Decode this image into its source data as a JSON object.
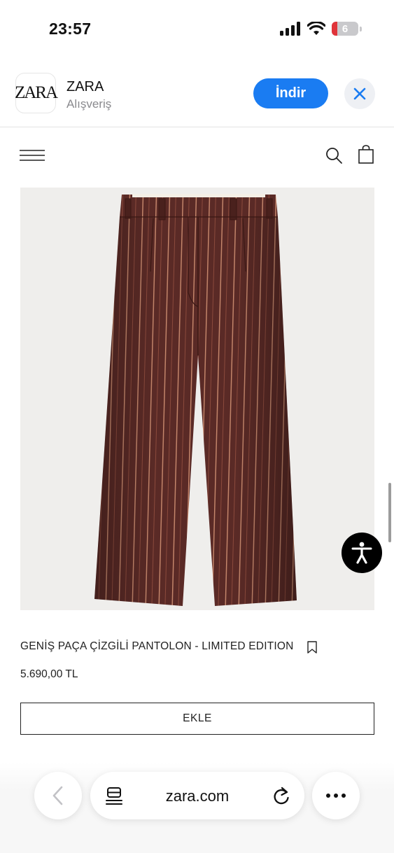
{
  "status_bar": {
    "time": "23:57",
    "battery_level": "6"
  },
  "app_banner": {
    "logo_text": "ZARA",
    "app_name": "ZARA",
    "category": "Alışveriş",
    "download_label": "İndir"
  },
  "site_header": {
    "menu_icon": "hamburger-menu-icon",
    "search_icon": "search-icon",
    "bag_icon": "shopping-bag-icon"
  },
  "product": {
    "name": "GENİŞ PAÇA ÇİZGİLİ PANTOLON - LIMITED EDITION",
    "price": "5.690,00 TL",
    "add_label": "EKLE"
  },
  "browser_bar": {
    "url": "zara.com"
  },
  "colors": {
    "accent": "#1a7cf2",
    "pants": "#5a2a26",
    "pinstripe": "#c98a6e",
    "background": "#efeeec"
  }
}
